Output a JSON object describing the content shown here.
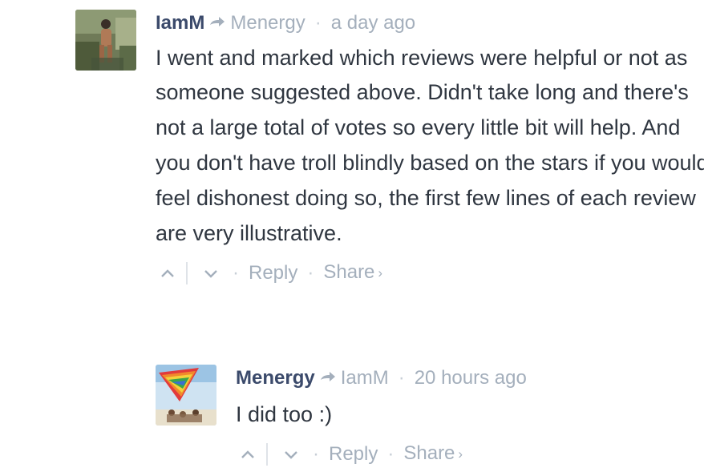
{
  "comments": [
    {
      "author": "IamM",
      "reply_to": "Menergy",
      "time": "a day ago",
      "text": "I went and marked which reviews were helpful or not as someone suggested above. Didn't take long and there's not a large total of votes so every little bit will help. And you don't have troll blindly based on the stars if you would feel dishonest doing so, the first few lines of each review are very illustrative.",
      "actions": {
        "reply": "Reply",
        "share": "Share"
      }
    },
    {
      "author": "Menergy",
      "reply_to": "IamM",
      "time": "20 hours ago",
      "text": "I did too :)",
      "actions": {
        "reply": "Reply",
        "share": "Share"
      }
    }
  ],
  "separator": "·",
  "share_chevron": "›",
  "colors": {
    "author": "#3b4a6b",
    "meta": "#a4afbc",
    "text": "#2f3640"
  }
}
